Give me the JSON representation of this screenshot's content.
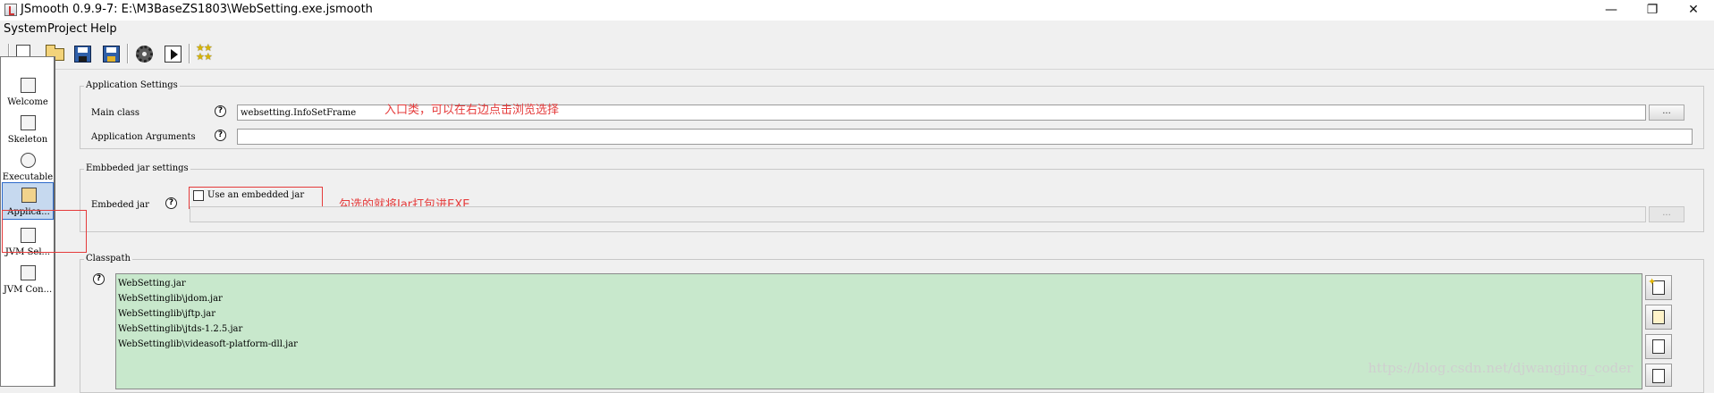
{
  "window": {
    "title": "JSmooth 0.9.9-7: E:\\M3BaseZS1803\\WebSetting.exe.jsmooth",
    "minimize": "—",
    "maximize": "❐",
    "close": "✕"
  },
  "menu": [
    "System",
    "Project",
    "Help"
  ],
  "toolbar": {
    "buttons": [
      "new-icon",
      "open-folder-icon",
      "save-icon",
      "save-as-icon",
      "compile-gear-icon",
      "run-icon",
      "about-stars-icon"
    ]
  },
  "sidebar": {
    "items": [
      {
        "label": "Welcome",
        "selected": false
      },
      {
        "label": "Skeleton",
        "selected": false
      },
      {
        "label": "Executable",
        "selected": false
      },
      {
        "label": "Applica...",
        "selected": true
      },
      {
        "label": "JVM Sel...",
        "selected": false
      },
      {
        "label": "JVM Con...",
        "selected": false
      }
    ]
  },
  "application_settings": {
    "title": "Application Settings",
    "main_class_label": "Main class",
    "main_class_value": "websetting.InfoSetFrame",
    "browse_label": "...",
    "arguments_label": "Application Arguments",
    "arguments_value": "",
    "help_glyph": "?"
  },
  "embedded_jar": {
    "title": "Embbeded jar settings",
    "label": "Embeded jar",
    "checkbox_label": "Use an embedded jar",
    "checked": false,
    "path_value": "",
    "browse_label": "..."
  },
  "classpath": {
    "title": "Classpath",
    "items": [
      "WebSetting.jar",
      "WebSettinglib\\jdom.jar",
      "WebSettinglib\\jftp.jar",
      "WebSettinglib\\jtds-1.2.5.jar",
      "WebSettinglib\\videasoft-platform-dll.jar"
    ]
  },
  "annotations": {
    "main_class_note": "入口类，可以在右边点击浏览选择",
    "embedded_note": "勾选的就将Jar打包进EXE"
  },
  "watermark": "https://blog.csdn.net/djwangjing_coder",
  "colors": {
    "annotation_red": "#e53b3b",
    "classpath_bg": "#c8e8cc",
    "selection_bg": "#c6d9ef"
  }
}
